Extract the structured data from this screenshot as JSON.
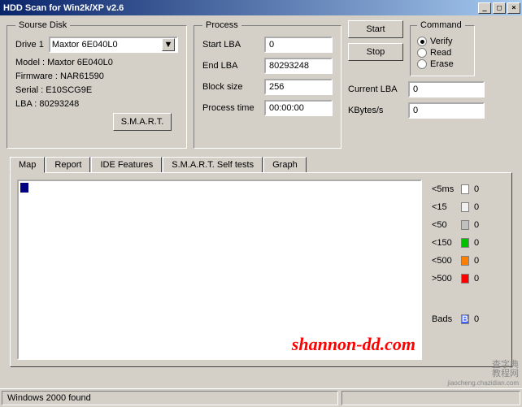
{
  "window": {
    "title": "HDD Scan for Win2k/XP  v2.6",
    "min": "_",
    "max": "□",
    "close": "×"
  },
  "sourse": {
    "legend": "Sourse Disk",
    "drive_label": "Drive  1",
    "drive_value": "Maxtor 6E040L0",
    "model": "Model : Maxtor 6E040L0",
    "firmware": "Firmware : NAR61590",
    "serial": "Serial : E10SCG9E",
    "lba": "LBA  :  80293248",
    "smart_btn": "S.M.A.R.T."
  },
  "process": {
    "legend": "Process",
    "start_lba_label": "Start LBA",
    "start_lba_value": "0",
    "end_lba_label": "End LBA",
    "end_lba_value": "80293248",
    "block_label": "Block size",
    "block_value": "256",
    "time_label": "Process time",
    "time_value": "00:00:00"
  },
  "buttons": {
    "start": "Start",
    "stop": "Stop"
  },
  "command": {
    "legend": "Command",
    "verify": "Verify",
    "read": "Read",
    "erase": "Erase"
  },
  "stats": {
    "current_lba_label": "Current LBA",
    "current_lba_value": "0",
    "kbytes_label": "KBytes/s",
    "kbytes_value": "0"
  },
  "tabs": {
    "map": "Map",
    "report": "Report",
    "ide": "IDE Features",
    "smart": "S.M.A.R.T. Self tests",
    "graph": "Graph"
  },
  "legend_items": [
    {
      "label": "<5ms",
      "color": "#ffffff",
      "count": "0"
    },
    {
      "label": "<15",
      "color": "#f0f0f0",
      "count": "0"
    },
    {
      "label": "<50",
      "color": "#c0c0c0",
      "count": "0"
    },
    {
      "label": "<150",
      "color": "#00c000",
      "count": "0"
    },
    {
      "label": "<500",
      "color": "#ff8000",
      "count": "0"
    },
    {
      "label": ">500",
      "color": "#ff0000",
      "count": "0"
    }
  ],
  "bads": {
    "label": "Bads",
    "color": "#4060ff",
    "count": "0"
  },
  "watermark": "shannon-dd.com",
  "status": "Windows 2000 found",
  "corner1": "查字典",
  "corner2": "教程网",
  "corner3": "jiaocheng.chazidian.com"
}
